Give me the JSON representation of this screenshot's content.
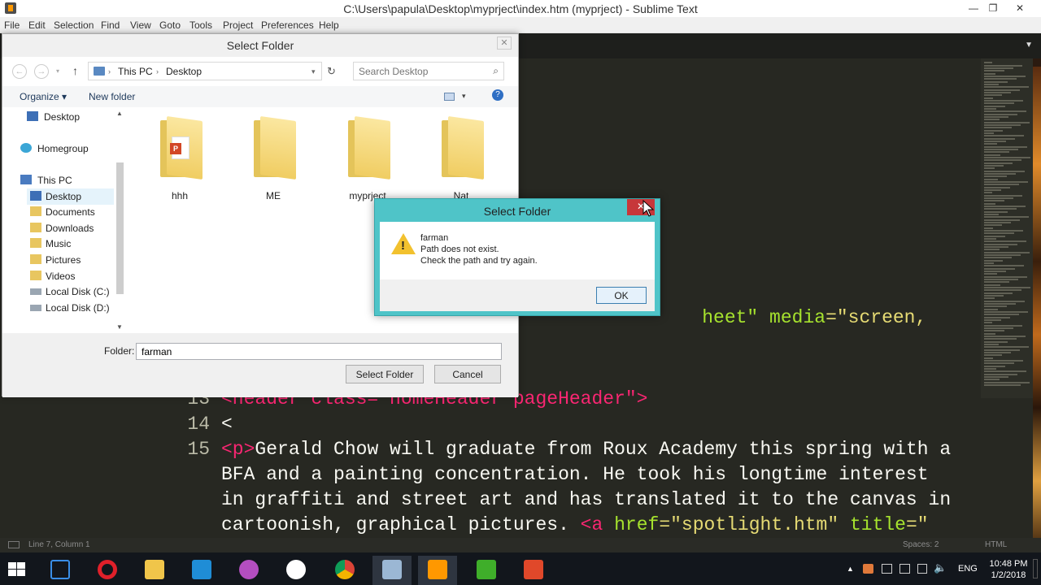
{
  "sublime": {
    "title": "C:\\Users\\papula\\Desktop\\myprject\\index.htm (myprject) - Sublime Text",
    "menu": [
      "File",
      "Edit",
      "Selection",
      "Find",
      "View",
      "Goto",
      "Tools",
      "Project",
      "Preferences",
      "Help"
    ],
    "code": {
      "line_a": "heet\" media=\"screen,",
      "line13_num": "13",
      "line13_text": "<header class=\"homeHeader pageHeader\">",
      "line14_num": "14",
      "line14_text": "<",
      "line15_num": "15",
      "line15_text_1_tag": "<p>",
      "line15_text_1_rest": "Gerald Chow will graduate from Roux Academy this spring with a",
      "line15_text_2": "BFA and a painting concentration. He took his longtime interest",
      "line15_text_3": "in graffiti and street art and has translated it to the canvas in",
      "line15_text_4_a": "cartoonish, graphical pictures. ",
      "line15_text_4_tag": "<a ",
      "line15_text_4_attr1": "href",
      "line15_text_4_val1": "=\"spotlight.htm\"",
      "line15_text_4_attr2": " title",
      "line15_text_4_val2": "=\""
    },
    "status": {
      "position": "Line 7, Column 1",
      "spaces": "Spaces: 2",
      "syntax": "HTML"
    }
  },
  "select_folder": {
    "title": "Select Folder",
    "address": [
      "This PC",
      "Desktop"
    ],
    "search_placeholder": "Search Desktop",
    "toolbar": {
      "organize": "Organize ▾",
      "new_folder": "New folder"
    },
    "sidebar": [
      {
        "label": "Desktop",
        "icon": "desktop-icon"
      },
      {
        "label": "Homegroup",
        "icon": "homegroup-icon"
      },
      {
        "label": "This PC",
        "icon": "computer-icon"
      },
      {
        "label": "Desktop",
        "icon": "desktop-icon"
      },
      {
        "label": "Documents",
        "icon": "folder-icon"
      },
      {
        "label": "Downloads",
        "icon": "folder-icon"
      },
      {
        "label": "Music",
        "icon": "folder-icon"
      },
      {
        "label": "Pictures",
        "icon": "folder-icon"
      },
      {
        "label": "Videos",
        "icon": "folder-icon"
      },
      {
        "label": "Local Disk (C:)",
        "icon": "drive-icon"
      },
      {
        "label": "Local Disk (D:)",
        "icon": "drive-icon"
      }
    ],
    "folders": [
      "hhh",
      "ME",
      "myprject",
      "Nat"
    ],
    "folder_label": "Folder:",
    "folder_value": "farman",
    "select_button": "Select Folder",
    "cancel_button": "Cancel"
  },
  "error_dialog": {
    "title": "Select Folder",
    "line1": "farman",
    "line2": "Path does not exist.",
    "line3": "Check the path and try again.",
    "ok": "OK",
    "close": "✕"
  },
  "taskbar": {
    "language": "ENG",
    "time": "10:48 PM",
    "date": "1/2/2018"
  }
}
